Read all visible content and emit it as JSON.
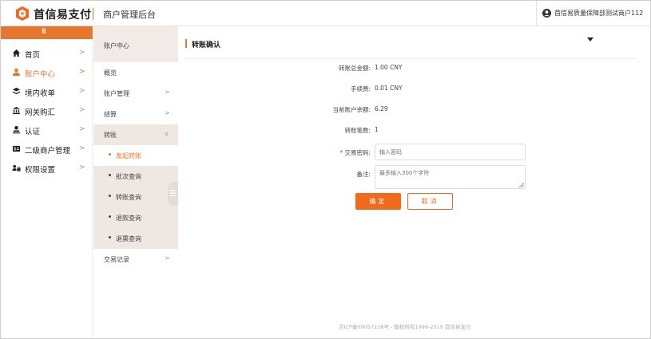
{
  "header": {
    "brand": "首信易支付",
    "subtitle": "商户管理后台",
    "user": "首信易质量保障部测试商户112"
  },
  "sidebar": {
    "collapse_icon": "III",
    "items": [
      {
        "label": "首页",
        "icon": "home-icon",
        "chevron": ">"
      },
      {
        "label": "账户中心",
        "icon": "user-icon",
        "chevron": ">",
        "active": true
      },
      {
        "label": "境内收单",
        "icon": "layers-icon",
        "chevron": ">"
      },
      {
        "label": "网关购汇",
        "icon": "bank-icon",
        "chevron": ">"
      },
      {
        "label": "认证",
        "icon": "person-icon",
        "chevron": ">"
      },
      {
        "label": "二级商户管理",
        "icon": "id-card-icon",
        "chevron": ">"
      },
      {
        "label": "权限设置",
        "icon": "lock-users-icon",
        "chevron": ">"
      }
    ]
  },
  "submenu": {
    "title": "账户中心",
    "items": [
      {
        "label": "概览"
      },
      {
        "label": "账户管理",
        "chevron": ">"
      },
      {
        "label": "结算",
        "chevron": ">"
      },
      {
        "label": "转账",
        "chevron": "v"
      },
      {
        "label": "发起转账",
        "child": true,
        "active": true
      },
      {
        "label": "批次查询",
        "child": true
      },
      {
        "label": "转账查询",
        "child": true
      },
      {
        "label": "退款查询",
        "child": true
      },
      {
        "label": "退票查询",
        "child": true
      },
      {
        "label": "交易记录",
        "chevron": ">"
      }
    ]
  },
  "main": {
    "title": "转账确认",
    "rows": [
      {
        "label": "转账总金额:",
        "value": "1.00 CNY"
      },
      {
        "label": "手续费:",
        "value": "0.01 CNY"
      },
      {
        "label": "当前账户余额:",
        "value": "6.29"
      },
      {
        "label": "转账笔数:",
        "value": "1"
      }
    ],
    "password_label": "交易密码:",
    "password_required_mark": "*",
    "password_placeholder": "输入密码",
    "remark_label": "备注:",
    "remark_placeholder": "最多输入300个字符",
    "ok_label": "确定",
    "cancel_label": "取消"
  },
  "footer": "京ICP备09057216号 - 版权所有1999-2019 首信易支付",
  "colors": {
    "accent": "#e8772e",
    "button": "#f26b1d",
    "submenu_bg": "#f1eae6"
  }
}
